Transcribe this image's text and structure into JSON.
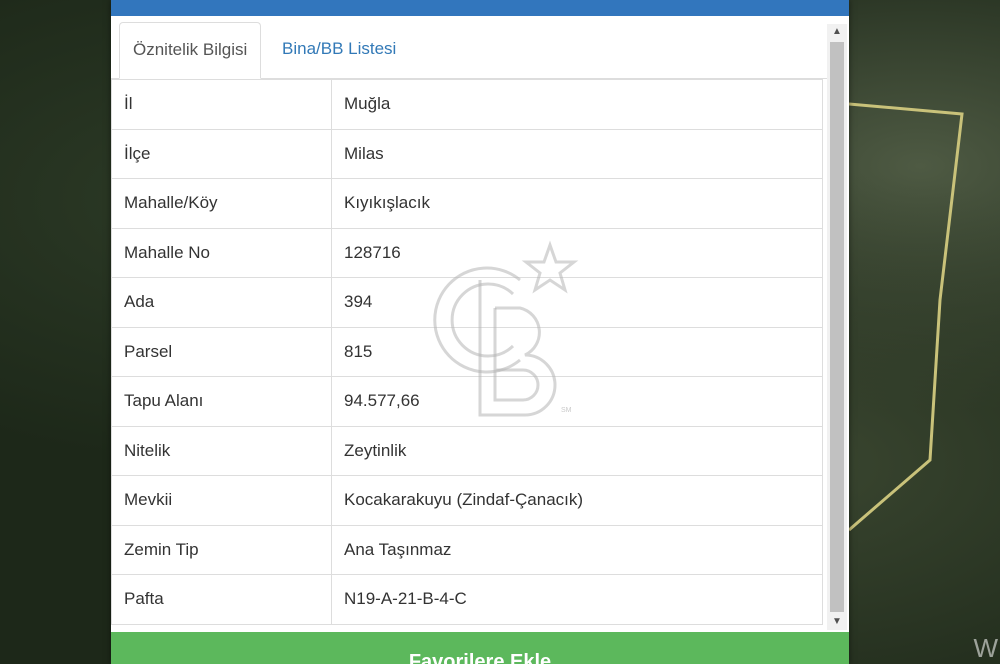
{
  "map": {
    "corner_text": "W"
  },
  "tabs": [
    {
      "label": "Öznitelik Bilgisi",
      "active": true
    },
    {
      "label": "Bina/BB Listesi",
      "active": false
    }
  ],
  "attributes": [
    {
      "key": "İl",
      "value": "Muğla"
    },
    {
      "key": "İlçe",
      "value": "Milas"
    },
    {
      "key": "Mahalle/Köy",
      "value": "Kıyıkışlacık"
    },
    {
      "key": "Mahalle No",
      "value": "128716"
    },
    {
      "key": "Ada",
      "value": "394"
    },
    {
      "key": "Parsel",
      "value": "815"
    },
    {
      "key": "Tapu Alanı",
      "value": "94.577,66"
    },
    {
      "key": "Nitelik",
      "value": "Zeytinlik"
    },
    {
      "key": "Mevkii",
      "value": "Kocakarakuyu (Zindaf-Çanacık)"
    },
    {
      "key": "Zemin Tip",
      "value": "Ana Taşınmaz"
    },
    {
      "key": "Pafta",
      "value": "N19-A-21-B-4-C"
    }
  ],
  "footer": {
    "label": "Favorilere Ekle"
  },
  "watermark": {
    "text": "CB",
    "mark": "SM"
  },
  "colors": {
    "header": "#3276bd",
    "tab_link": "#3279b7",
    "footer": "#5cb85c",
    "parcel_outline": "#c9c27a"
  }
}
